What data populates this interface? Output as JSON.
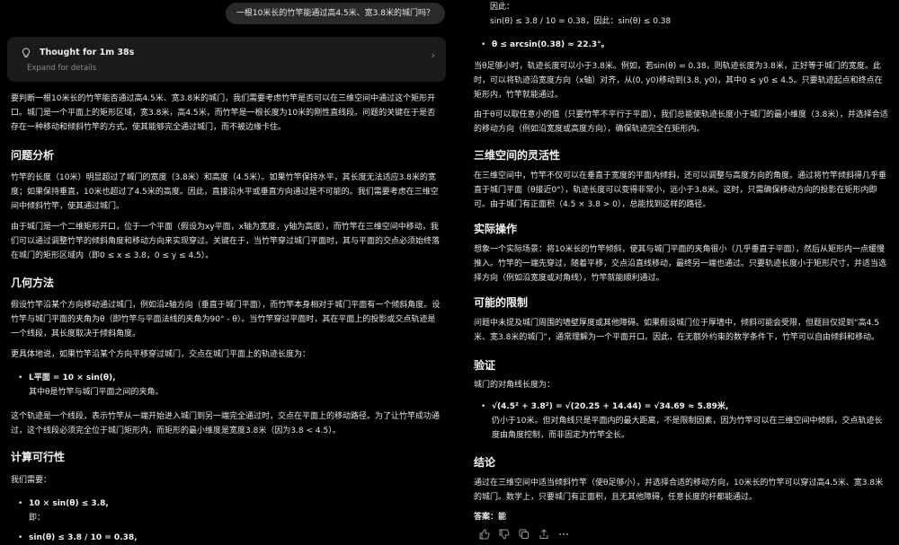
{
  "user_question": "一根10米长的竹竿能通过高4.5米、宽3.8米的城门吗？",
  "thought": {
    "title": "Thought for 1m 38s",
    "subtitle": "Expand for details"
  },
  "left": {
    "intro": "要判断一根10米长的竹竿能否通过高4.5米、宽3.8米的城门，我们需要考虑竹竿是否可以在三维空间中通过这个矩形开口。城门是一个平面上的矩形区域，宽3.8米，高4.5米，而竹竿是一根长度为10米的刚性直线段。问题的关键在于是否存在一种移动和倾斜竹竿的方式，使其能够完全通过城门，而不被边缘卡住。",
    "h_problem": "问题分析",
    "problem_p1": "竹竿的长度（10米）明显超过了城门的宽度（3.8米）和高度（4.5米）。如果竹竿保持水平，其长度无法适应3.8米的宽度；如果保持垂直，10米也超过了4.5米的高度。因此，直接沿水平或垂直方向通过是不可能的。我们需要考虑在三维空间中倾斜竹竿，使其通过城门。",
    "problem_p2": "由于城门是一个二维矩形开口，位于一个平面（假设为xy平面，x轴为宽度，y轴为高度），而竹竿在三维空间中移动，我们可以通过调整竹竿的倾斜角度和移动方向来实现穿过。关键在于，当竹竿穿过城门平面时，其与平面的交点必须始终落在城门的矩形区域内（即0 ≤ x ≤ 3.8，0 ≤ y ≤ 4.5）。",
    "h_geometry": "几何方法",
    "geometry_p1": "假设竹竿沿某个方向移动通过城门，例如沿z轴方向（垂直于城门平面），而竹竿本身相对于城门平面有一个倾斜角度。设竹竿与城门平面的夹角为θ（即竹竿与平面法线的夹角为90° - θ）。当竹竿穿过平面时，其在平面上的投影或交点轨迹是一个线段，其长度取决于倾斜角度。",
    "geometry_p2": "更具体地说，如果竹竿沿某个方向平移穿过城门，交点在城门平面上的轨迹长度为：",
    "geometry_formula": "L平面 = 10 × sin(θ),",
    "geometry_formula_note": "其中θ是竹竿与城门平面之间的夹角。",
    "geometry_p3": "这个轨迹是一个线段，表示竹竿从一端开始进入城门到另一端完全通过时，交点在平面上的移动路径。为了让竹竿成功通过，这个线段必须完全位于城门矩形内，而矩形的最小维度是宽度3.8米（因为3.8 < 4.5）。",
    "h_feasibility": "计算可行性",
    "feasibility_intro": "我们需要：",
    "feasibility_f1": "10 × sin(θ) ≤ 3.8,",
    "feasibility_f1_note": "即：",
    "feasibility_f2": "sin(θ) ≤ 3.8 / 10 = 0.38,"
  },
  "right": {
    "cont_1": "因此：",
    "cont_2": "sin(θ) ≤ 3.8 / 10 = 0.38，因此：sin(θ) ≤ 0.38",
    "theta_result": "θ ≤ arcsin(0.38) ≈ 22.3°。",
    "theta_p1": "当θ足够小时，轨迹长度可以小于3.8米。例如，若sin(θ) = 0.38，则轨迹长度为3.8米，正好等于城门的宽度。此时，可以将轨迹沿宽度方向（x轴）对齐，从(0, y0)移动到(3.8, y0)，其中0 ≤ y0 ≤ 4.5。只要轨迹起点和终点在矩形内，竹竿就能通过。",
    "theta_p2": "由于θ可以取任意小的值（只要竹竿不平行于平面），我们总能使轨迹长度小于城门的最小维度（3.8米），并选择合适的移动方向（例如沿宽度或高度方向），确保轨迹完全在矩形内。",
    "h_3d": "三维空间的灵活性",
    "p_3d": "在三维空间中，竹竿不仅可以在垂直于宽度的平面内倾斜，还可以调整与高度方向的角度。通过将竹竿倾斜得几乎垂直于城门平面（θ接近0°），轨迹长度可以变得非常小，远小于3.8米。这时，只需确保移动方向的投影在矩形内即可。由于城门有正面积（4.5 × 3.8 > 0），总能找到这样的路径。",
    "h_practice": "实际操作",
    "p_practice": "想象一个实际场景：将10米长的竹竿倾斜，使其与城门平面的夹角很小（几乎垂直于平面），然后从矩形内一点缓慢推入。竹竿的一端先穿过，随着平移，交点沿直线移动，最终另一端也通过。只要轨迹长度小于矩形尺寸，并适当选择方向（例如沿宽度或对角线），竹竿就能顺利通过。",
    "h_limits": "可能的限制",
    "p_limits": "问题中未提及城门周围的墙壁厚度或其他障碍。如果假设城门位于厚墙中，倾斜可能会受限，但题目仅提到“高4.5米、宽3.8米的城门”，通常理解为一个平面开口。因此，在无额外约束的数学条件下，竹竿可以自由倾斜和移动。",
    "h_verify": "验证",
    "verify_intro": "城门的对角线长度为：",
    "verify_formula": "√(4.5² + 3.8²) = √(20.25 + 14.44) = √34.69 ≈ 5.89米,",
    "verify_note": "仍小于10米。但对角线只是平面内的最大距离，不是限制因素，因为竹竿可以在三维空间中倾斜，交点轨迹长度由角度控制，而非固定为竹竿全长。",
    "h_conclusion": "结论",
    "p_conclusion": "通过在三维空间中适当倾斜竹竿（使θ足够小），并选择合适的移动方向，10米长的竹竿可以穿过高4.5米、宽3.8米的城门。数学上，只要城门有正面积，且无其他障碍，任意长度的杆都能通过。",
    "answer": "答案：能"
  },
  "icons": [
    "bulb-icon",
    "chevron-right-icon",
    "thumbs-up-icon",
    "thumbs-down-icon",
    "copy-icon",
    "share-icon",
    "more-icon"
  ]
}
